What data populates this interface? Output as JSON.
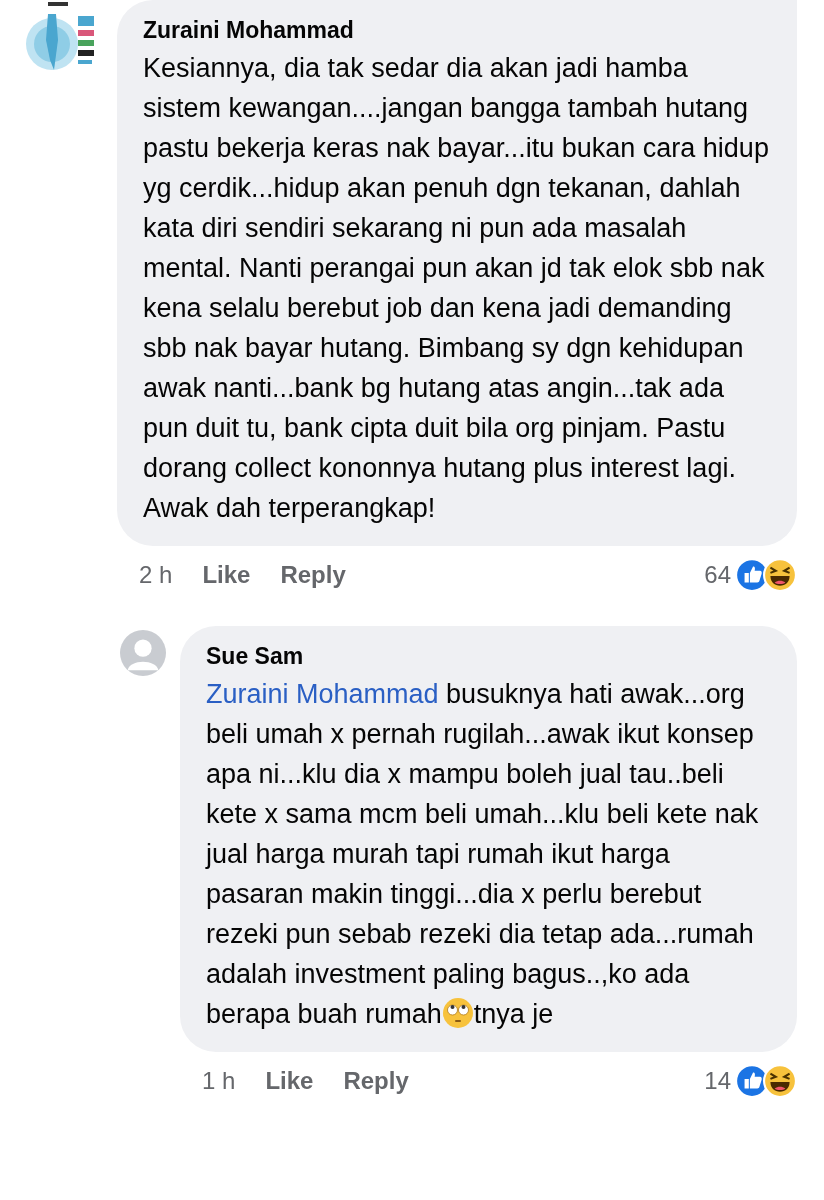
{
  "comments": [
    {
      "author": "Zuraini Mohammad",
      "avatar": {
        "kind": "picture"
      },
      "segments": [
        {
          "kind": "text",
          "text": "Kesiannya, dia tak sedar dia akan jadi hamba sistem kewangan....jangan bangga tambah hutang pastu bekerja keras nak bayar...itu bukan cara hidup yg cerdik...hidup akan penuh dgn tekanan, dahlah kata diri sendiri sekarang ni pun ada masalah mental. Nanti perangai pun akan jd tak elok sbb nak kena selalu berebut job dan kena jadi demanding sbb nak bayar hutang. Bimbang sy dgn kehidupan awak nanti...bank bg hutang atas angin...tak ada pun duit tu, bank cipta duit bila org pinjam. Pastu dorang collect kononnya hutang plus interest lagi. Awak dah terperangkap!"
        }
      ],
      "time": "2 h",
      "actions": [
        "Like",
        "Reply"
      ],
      "reaction_count": "64",
      "reply": false
    },
    {
      "author": "Sue Sam",
      "avatar": {
        "kind": "silhouette"
      },
      "segments": [
        {
          "kind": "mention",
          "text": "Zuraini Mohammad"
        },
        {
          "kind": "text",
          "text": " busuknya hati awak...org beli umah x pernah rugilah...awak ikut konsep apa ni...klu dia x mampu boleh jual tau..beli kete x sama mcm beli umah...klu beli kete nak jual harga murah tapi rumah ikut harga pasaran makin tinggi...dia x perlu berebut rezeki pun sebab rezeki dia tetap ada...rumah adalah investment paling bagus..,ko ada berapa buah rumah"
        },
        {
          "kind": "emoji"
        },
        {
          "kind": "text",
          "text": "tnya je"
        }
      ],
      "time": "1 h",
      "actions": [
        "Like",
        "Reply"
      ],
      "reaction_count": "14",
      "reply": true
    }
  ]
}
